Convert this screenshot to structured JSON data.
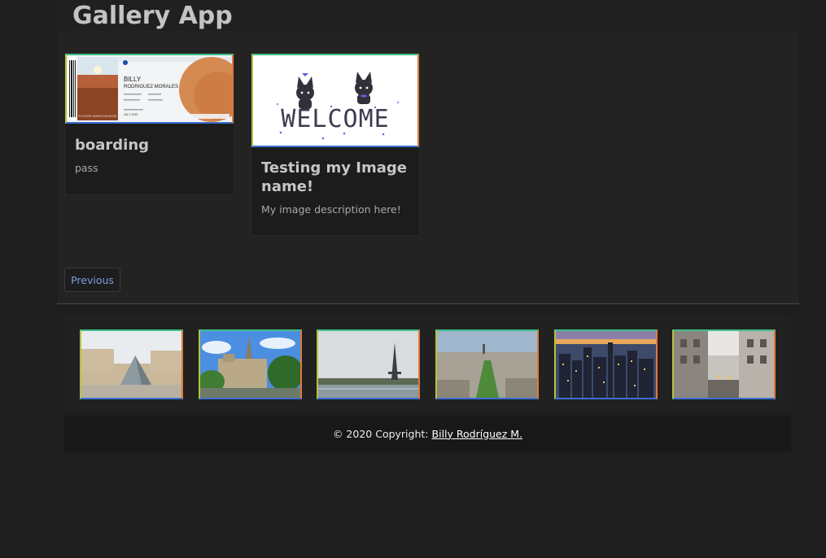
{
  "app": {
    "title": "Gallery App"
  },
  "cards": [
    {
      "title": "boarding",
      "description": "pass",
      "image": {
        "name": "BILLY",
        "name2": "RODRIGUEZ MORALES",
        "caption": "FUTURE MARS MISSION",
        "date": "JULY 2020"
      }
    },
    {
      "title": "Testing my Image name!",
      "description": "My image description here!",
      "image": {
        "word": "WELCOME"
      }
    }
  ],
  "pagination": {
    "previous_label": "Previous"
  },
  "thumbnails": [
    {
      "subject": "louvre-pyramid"
    },
    {
      "subject": "notre-dame"
    },
    {
      "subject": "eiffel-tower"
    },
    {
      "subject": "champ-de-mars"
    },
    {
      "subject": "city-skyline-dusk"
    },
    {
      "subject": "paris-street"
    }
  ],
  "footer": {
    "copyright": "© 2020 Copyright:",
    "author_link": "Billy Rodríguez M."
  },
  "colors": {
    "page_bg": "#1e1e1e",
    "link_blue": "#7d9ce0",
    "border_green": "#3fbf8a",
    "border_orange": "#e07a3a",
    "border_blue": "#3a6fd0"
  }
}
